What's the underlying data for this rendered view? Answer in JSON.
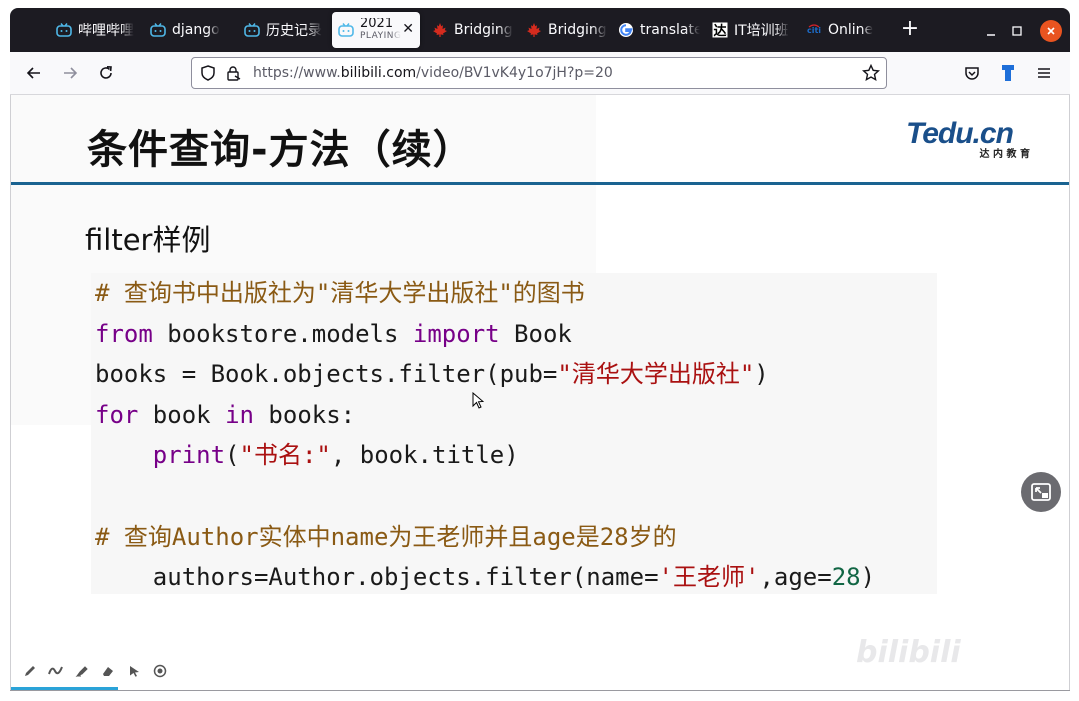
{
  "browser": {
    "tabs": [
      {
        "label": "哔哩哔哩",
        "icon": "bilibili-tv-icon",
        "active": false
      },
      {
        "label": "django",
        "icon": "bilibili-tv-icon",
        "active": false
      },
      {
        "label": "历史记录",
        "icon": "bilibili-tv-icon",
        "active": false
      },
      {
        "label": "2021",
        "sublabel": "PLAYING",
        "icon": "bilibili-tv-icon",
        "active": true
      },
      {
        "label": "Bridging",
        "icon": "maple-leaf-icon",
        "active": false
      },
      {
        "label": "Bridging",
        "icon": "maple-leaf-icon",
        "active": false
      },
      {
        "label": "translate",
        "icon": "google-icon",
        "active": false
      },
      {
        "label": "IT培训班",
        "icon": "da-logo-icon",
        "active": false
      },
      {
        "label": "Online",
        "icon": "citi-logo-icon",
        "active": false
      }
    ],
    "new_tab_glyph": "+",
    "url": {
      "prefix": "https://www.",
      "domain": "bilibili.com",
      "path": "/video/BV1vK4y1o7jH?p=20"
    },
    "accent_color": "#1c1b22"
  },
  "slide": {
    "title": "条件查询-方法（续）",
    "logo_text": "Tedu.cn",
    "logo_subtext": "达 内 教 育",
    "subtitle": "filter样例",
    "code_lines": [
      [
        {
          "t": "# 查询书中出版社为\"清华大学出版社\"的图书",
          "c": "com"
        }
      ],
      [
        {
          "t": "from",
          "c": "kw"
        },
        {
          "t": " bookstore.models ",
          "c": ""
        },
        {
          "t": "import",
          "c": "kw"
        },
        {
          "t": " Book",
          "c": ""
        }
      ],
      [
        {
          "t": "books = Book.objects.filter(pub=",
          "c": ""
        },
        {
          "t": "\"清华大学出版社\"",
          "c": "str"
        },
        {
          "t": ")",
          "c": ""
        }
      ],
      [
        {
          "t": "for",
          "c": "kw"
        },
        {
          "t": " book ",
          "c": ""
        },
        {
          "t": "in",
          "c": "kw"
        },
        {
          "t": " books:",
          "c": ""
        }
      ],
      [
        {
          "t": "    ",
          "c": ""
        },
        {
          "t": "print",
          "c": "kw"
        },
        {
          "t": "(",
          "c": ""
        },
        {
          "t": "\"书名:\"",
          "c": "str"
        },
        {
          "t": ", book.title)",
          "c": ""
        }
      ],
      [
        {
          "t": "",
          "c": ""
        }
      ],
      [
        {
          "t": "# 查询Author实体中name为王老师并且age是28岁的",
          "c": "com"
        }
      ],
      [
        {
          "t": "    authors=Author.objects.filter(name=",
          "c": ""
        },
        {
          "t": "'王老师'",
          "c": "str"
        },
        {
          "t": ",age=",
          "c": ""
        },
        {
          "t": "28",
          "c": "num"
        },
        {
          "t": ")",
          "c": ""
        }
      ]
    ],
    "watermark": "bilibili"
  }
}
